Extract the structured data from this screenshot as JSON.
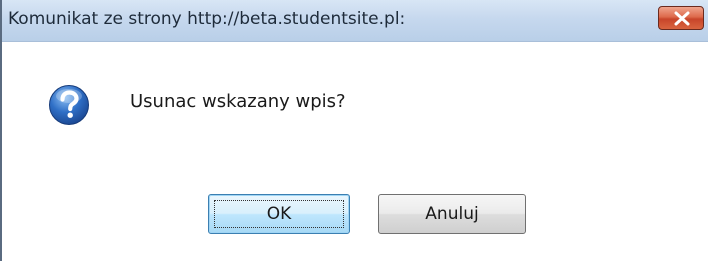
{
  "dialog": {
    "title": "Komunikat ze strony http://beta.studentsite.pl:",
    "close_icon": "close-icon",
    "message_icon": "question-icon",
    "message": "Usunac wskazany wpis?",
    "buttons": {
      "ok_label": "OK",
      "cancel_label": "Anuluj"
    }
  },
  "colors": {
    "titlebar": "#c6d8ee",
    "close_button": "#c8452a",
    "question_icon": "#2a63b8",
    "ok_button_focus": "#3c7fb1"
  }
}
